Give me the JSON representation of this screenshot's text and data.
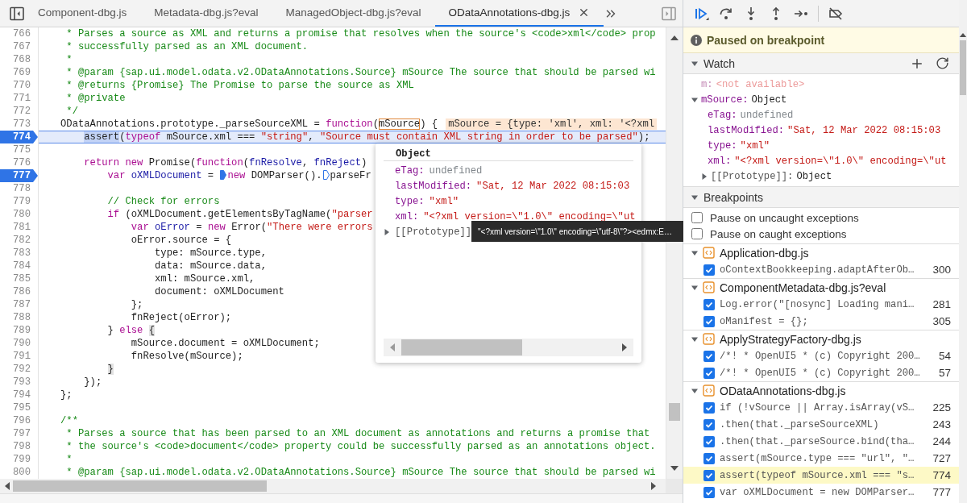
{
  "tabs": [
    {
      "label": "Component-dbg.js",
      "selected": false
    },
    {
      "label": "Metadata-dbg.js?eval",
      "selected": false
    },
    {
      "label": "ManagedObject-dbg.js?eval",
      "selected": false
    },
    {
      "label": "ODataAnnotations-dbg.js",
      "selected": true
    }
  ],
  "editor": {
    "lines": [
      {
        "number": "766",
        "breakpoint": false,
        "current": false,
        "tokens": [
          {
            "kind": "comment",
            "text": " * Parses a source as XML and returns a promise that resolves when the source's <code>xml</code> prop"
          }
        ]
      },
      {
        "number": "767",
        "breakpoint": false,
        "current": false,
        "tokens": [
          {
            "kind": "comment",
            "text": " * successfully parsed as an XML document."
          }
        ]
      },
      {
        "number": "768",
        "breakpoint": false,
        "current": false,
        "tokens": [
          {
            "kind": "comment",
            "text": " *"
          }
        ]
      },
      {
        "number": "769",
        "breakpoint": false,
        "current": false,
        "tokens": [
          {
            "kind": "comment",
            "text": " * @param {sap.ui.model.odata.v2.ODataAnnotations.Source} mSource The source that should be parsed wi"
          }
        ]
      },
      {
        "number": "770",
        "breakpoint": false,
        "current": false,
        "tokens": [
          {
            "kind": "comment",
            "text": " * @returns {Promise} The Promise to parse the source as XML"
          }
        ]
      },
      {
        "number": "771",
        "breakpoint": false,
        "current": false,
        "tokens": [
          {
            "kind": "comment",
            "text": " * @private"
          }
        ]
      },
      {
        "number": "772",
        "breakpoint": false,
        "current": false,
        "tokens": [
          {
            "kind": "comment",
            "text": " */"
          }
        ]
      },
      {
        "number": "773",
        "breakpoint": false,
        "current": false,
        "tokens": [
          {
            "kind": "plain",
            "text": "ODataAnnotations.prototype._parseSourceXML = "
          },
          {
            "kind": "keyword",
            "text": "function"
          },
          {
            "kind": "plain",
            "text": "("
          },
          {
            "kind": "hover",
            "text": "mSource"
          },
          {
            "kind": "plain",
            "text": ") {"
          },
          {
            "kind": "inline",
            "text": "mSource = {type: 'xml', xml: '<?xml"
          }
        ]
      },
      {
        "number": "774",
        "breakpoint": true,
        "current": true,
        "tokens": [
          {
            "kind": "selection",
            "text": "    assert"
          },
          {
            "kind": "plain",
            "text": "("
          },
          {
            "kind": "keyword",
            "text": "typeof"
          },
          {
            "kind": "plain",
            "text": " mSource.xml === "
          },
          {
            "kind": "string",
            "text": "\"string\""
          },
          {
            "kind": "plain",
            "text": ", "
          },
          {
            "kind": "string",
            "text": "\"Source must contain XML string in order to be parsed\""
          },
          {
            "kind": "plain",
            "text": ");"
          }
        ]
      },
      {
        "number": "775",
        "breakpoint": false,
        "current": false
      },
      {
        "number": "776",
        "breakpoint": false,
        "current": false,
        "tokens": [
          {
            "kind": "keyword",
            "text": "    return new"
          },
          {
            "kind": "plain",
            "text": " Promise("
          },
          {
            "kind": "keyword",
            "text": "function"
          },
          {
            "kind": "plain",
            "text": "("
          },
          {
            "kind": "def",
            "text": "fnResolve"
          },
          {
            "kind": "plain",
            "text": ", "
          },
          {
            "kind": "def",
            "text": "fnReject"
          },
          {
            "kind": "plain",
            "text": ")"
          }
        ]
      },
      {
        "number": "777",
        "breakpoint": true,
        "current": false,
        "tokens": [
          {
            "kind": "keyword",
            "text": "        var"
          },
          {
            "kind": "def",
            "text": " oXMLDocument"
          },
          {
            "kind": "plain",
            "text": " = "
          },
          {
            "kind": "breakpoint_on"
          },
          {
            "kind": "keyword",
            "text": "new"
          },
          {
            "kind": "plain",
            "text": " DOMParser()."
          },
          {
            "kind": "breakpoint_off"
          },
          {
            "kind": "plain",
            "text": "parseFr"
          }
        ]
      },
      {
        "number": "778",
        "breakpoint": false,
        "current": false
      },
      {
        "number": "779",
        "breakpoint": false,
        "current": false,
        "tokens": [
          {
            "kind": "comment",
            "text": "        // Check for errors"
          }
        ]
      },
      {
        "number": "780",
        "breakpoint": false,
        "current": false,
        "tokens": [
          {
            "kind": "keyword",
            "text": "        if"
          },
          {
            "kind": "plain",
            "text": " (oXMLDocument.getElementsByTagName("
          },
          {
            "kind": "string",
            "text": "\"parser"
          }
        ]
      },
      {
        "number": "781",
        "breakpoint": false,
        "current": false,
        "tokens": [
          {
            "kind": "keyword",
            "text": "            var"
          },
          {
            "kind": "def",
            "text": " oError"
          },
          {
            "kind": "plain",
            "text": " = "
          },
          {
            "kind": "keyword",
            "text": "new"
          },
          {
            "kind": "plain",
            "text": " Error("
          },
          {
            "kind": "string",
            "text": "\"There were errors"
          }
        ]
      },
      {
        "number": "782",
        "breakpoint": false,
        "current": false,
        "tokens": [
          {
            "kind": "plain",
            "text": "            oError.source = {"
          }
        ]
      },
      {
        "number": "783",
        "breakpoint": false,
        "current": false,
        "tokens": [
          {
            "kind": "plain",
            "text": "                type: mSource.type,"
          }
        ]
      },
      {
        "number": "784",
        "breakpoint": false,
        "current": false,
        "tokens": [
          {
            "kind": "plain",
            "text": "                data: mSource.data,"
          }
        ]
      },
      {
        "number": "785",
        "breakpoint": false,
        "current": false,
        "tokens": [
          {
            "kind": "plain",
            "text": "                xml: mSource.xml,"
          }
        ]
      },
      {
        "number": "786",
        "breakpoint": false,
        "current": false,
        "tokens": [
          {
            "kind": "plain",
            "text": "                document: oXMLDocument"
          }
        ]
      },
      {
        "number": "787",
        "breakpoint": false,
        "current": false,
        "tokens": [
          {
            "kind": "plain",
            "text": "            };"
          }
        ]
      },
      {
        "number": "788",
        "breakpoint": false,
        "current": false,
        "tokens": [
          {
            "kind": "plain",
            "text": "            fnReject(oError);"
          }
        ]
      },
      {
        "number": "789",
        "breakpoint": false,
        "current": false,
        "tokens": [
          {
            "kind": "plain",
            "text": "        } "
          },
          {
            "kind": "keyword",
            "text": "else "
          },
          {
            "kind": "match",
            "text": "{"
          }
        ]
      },
      {
        "number": "790",
        "breakpoint": false,
        "current": false,
        "tokens": [
          {
            "kind": "plain",
            "text": "            mSource.document = oXMLDocument;"
          }
        ]
      },
      {
        "number": "791",
        "breakpoint": false,
        "current": false,
        "tokens": [
          {
            "kind": "plain",
            "text": "            fnResolve(mSource);"
          }
        ]
      },
      {
        "number": "792",
        "breakpoint": false,
        "current": false,
        "tokens": [
          {
            "kind": "match",
            "text": "        }"
          }
        ]
      },
      {
        "number": "793",
        "breakpoint": false,
        "current": false,
        "tokens": [
          {
            "kind": "plain",
            "text": "    });"
          }
        ]
      },
      {
        "number": "794",
        "breakpoint": false,
        "current": false,
        "tokens": [
          {
            "kind": "plain",
            "text": "};"
          }
        ]
      },
      {
        "number": "795",
        "breakpoint": false,
        "current": false
      },
      {
        "number": "796",
        "breakpoint": false,
        "current": false,
        "tokens": [
          {
            "kind": "comment",
            "text": "/**"
          }
        ]
      },
      {
        "number": "797",
        "breakpoint": false,
        "current": false,
        "tokens": [
          {
            "kind": "comment",
            "text": " * Parses a source that has been parsed to an XML document as annotations and returns a promise that"
          }
        ]
      },
      {
        "number": "798",
        "breakpoint": false,
        "current": false,
        "tokens": [
          {
            "kind": "comment",
            "text": " * the source's <code>document</code> property could be successfully parsed as an annotations object."
          }
        ]
      },
      {
        "number": "799",
        "breakpoint": false,
        "current": false,
        "tokens": [
          {
            "kind": "comment",
            "text": " *"
          }
        ]
      },
      {
        "number": "800",
        "breakpoint": false,
        "current": false,
        "tokens": [
          {
            "kind": "comment",
            "text": " * @param {sap.ui.model.odata.v2.ODataAnnotations.Source} mSource The source that should be parsed wi"
          }
        ]
      }
    ]
  },
  "popover": {
    "title": "Object",
    "properties": [
      {
        "name": "eTag:",
        "value": "undefined",
        "kind": "undefined"
      },
      {
        "name": "lastModified:",
        "value": "\"Sat, 12 Mar 2022 08:15:03",
        "kind": "string"
      },
      {
        "name": "type:",
        "value": "\"xml\"",
        "kind": "string"
      },
      {
        "name": "xml:",
        "value": "\"<?xml version=\\\"1.0\\\" encoding=\\\"ut",
        "kind": "string"
      },
      {
        "name": "[[Prototype]]",
        "kind": "prototype",
        "expanded": false
      }
    ]
  },
  "tooltip": {
    "text": "\"<?xml version=\\\"1.0\\\" encoding=\\\"utf-8\\\"?><edmx:E…"
  },
  "banner": {
    "text": "Paused on breakpoint"
  },
  "watch": {
    "title": "Watch",
    "expanded": true,
    "items": [
      {
        "name": "m:",
        "value": "<not available>",
        "kind": "unavailable"
      },
      {
        "name": "mSource:",
        "value": "Object",
        "kind": "object",
        "expanded": true,
        "children": [
          {
            "name": "eTag:",
            "value": "undefined",
            "kind": "undefined"
          },
          {
            "name": "lastModified:",
            "value": "\"Sat, 12 Mar 2022 08:15:03",
            "kind": "string"
          },
          {
            "name": "type:",
            "value": "\"xml\"",
            "kind": "string"
          },
          {
            "name": "xml:",
            "value": "\"<?xml version=\\\"1.0\\\" encoding=\\\"ut",
            "kind": "string"
          },
          {
            "name": "[[Prototype]]:",
            "value": "Object",
            "kind": "object",
            "expanded": false
          }
        ]
      }
    ]
  },
  "breakpoints": {
    "title": "Breakpoints",
    "expanded": true,
    "options": [
      {
        "label": "Pause on uncaught exceptions",
        "checked": false
      },
      {
        "label": "Pause on caught exceptions",
        "checked": false
      }
    ],
    "files": [
      {
        "name": "Application-dbg.js",
        "expanded": true,
        "items": [
          {
            "code": "oContextBookkeeping.adaptAfterOb…",
            "line": "300",
            "checked": true,
            "hit": false
          }
        ]
      },
      {
        "name": "ComponentMetadata-dbg.js?eval",
        "expanded": true,
        "items": [
          {
            "code": "Log.error(\"[nosync] Loading mani…",
            "line": "281",
            "checked": true,
            "hit": false
          },
          {
            "code": "oManifest = {};",
            "line": "305",
            "checked": true,
            "hit": false
          }
        ]
      },
      {
        "name": "ApplyStrategyFactory-dbg.js",
        "expanded": true,
        "items": [
          {
            "code": "/*! * OpenUI5 * (c) Copyright 200…",
            "line": "54",
            "checked": true,
            "hit": false
          },
          {
            "code": "/*! * OpenUI5 * (c) Copyright 200…",
            "line": "57",
            "checked": true,
            "hit": false
          }
        ]
      },
      {
        "name": "ODataAnnotations-dbg.js",
        "expanded": true,
        "items": [
          {
            "code": "if (!vSource || Array.isArray(vS…",
            "line": "225",
            "checked": true,
            "hit": false
          },
          {
            "code": ".then(that._parseSourceXML)",
            "line": "243",
            "checked": true,
            "hit": false
          },
          {
            "code": ".then(that._parseSource.bind(tha…",
            "line": "244",
            "checked": true,
            "hit": false
          },
          {
            "code": "assert(mSource.type === \"url\", \"…",
            "line": "727",
            "checked": true,
            "hit": false
          },
          {
            "code": "assert(typeof mSource.xml === \"s…",
            "line": "774",
            "checked": true,
            "hit": true
          },
          {
            "code": "var oXMLDocument = new DOMParser…",
            "line": "777",
            "checked": true,
            "hit": false
          }
        ]
      }
    ]
  }
}
